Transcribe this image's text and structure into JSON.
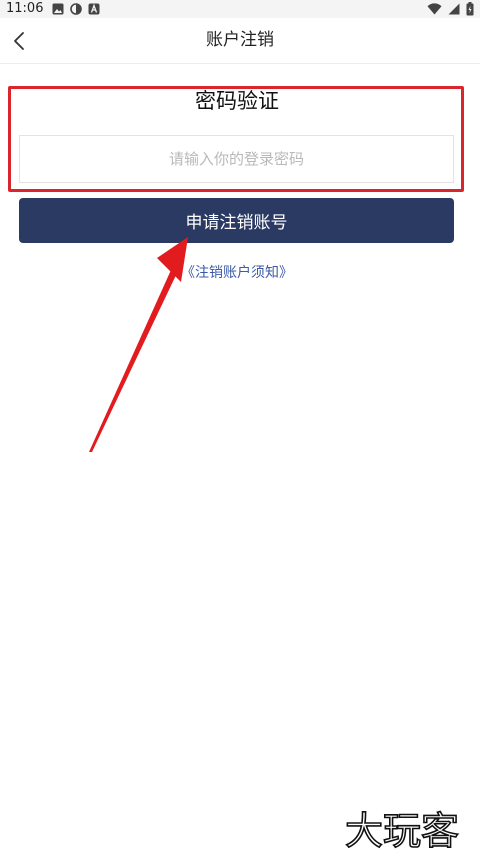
{
  "status_bar": {
    "time": "11:06"
  },
  "nav": {
    "title": "账户注销"
  },
  "verification": {
    "title": "密码验证",
    "password_placeholder": "请输入你的登录密码",
    "password_value": ""
  },
  "actions": {
    "apply_label": "申请注销账号",
    "notice_link": "《注销账户须知》"
  },
  "colors": {
    "primary_button": "#2b3a63",
    "link": "#3d5aa7",
    "annotation_red": "#d9252c"
  },
  "watermark": {
    "text": "大玩客"
  }
}
